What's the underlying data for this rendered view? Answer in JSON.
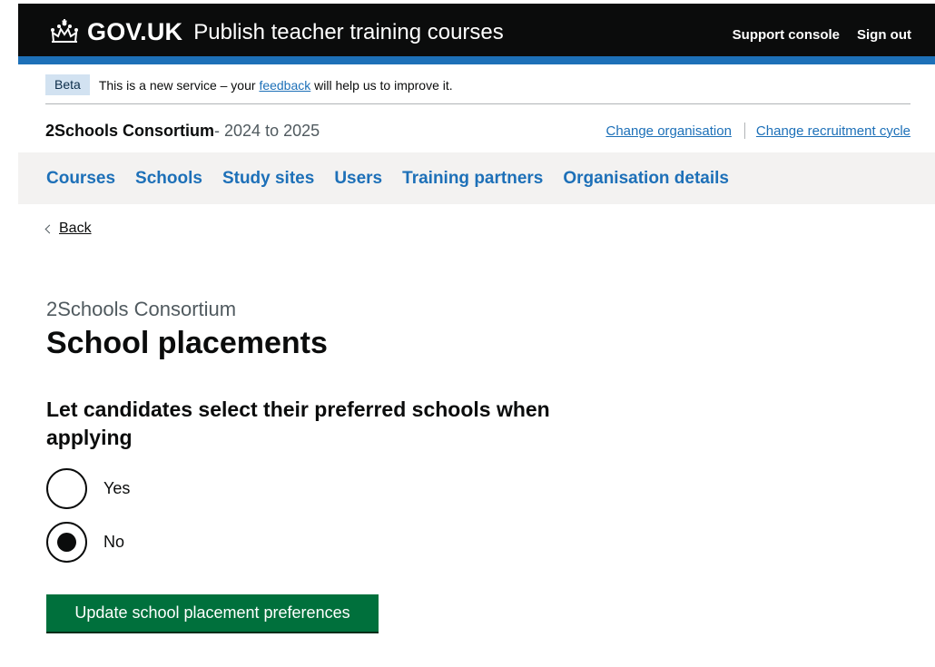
{
  "header": {
    "logotype": "GOV.UK",
    "service_name": "Publish teacher training courses",
    "links": [
      "Support console",
      "Sign out"
    ]
  },
  "phase_banner": {
    "tag": "Beta",
    "text_before": "This is a new service – your ",
    "link": "feedback",
    "text_after": " will help us to improve it."
  },
  "organisation": {
    "name": "2Schools Consortium",
    "cycle": " - 2024 to 2025",
    "change_org": "Change organisation",
    "change_cycle": "Change recruitment cycle"
  },
  "nav": [
    "Courses",
    "Schools",
    "Study sites",
    "Users",
    "Training partners",
    "Organisation details"
  ],
  "back_label": "Back",
  "page": {
    "caption": "2Schools Consortium",
    "title": "School placements",
    "legend": "Let candidates select their preferred schools when applying",
    "options": [
      {
        "label": "Yes",
        "checked": false
      },
      {
        "label": "No",
        "checked": true
      }
    ],
    "button": "Update school placement preferences"
  },
  "colors": {
    "header_bg": "#0b0c0c",
    "brand_blue": "#1d70b8",
    "button_green": "#00703c",
    "nav_bg": "#f3f2f1"
  }
}
